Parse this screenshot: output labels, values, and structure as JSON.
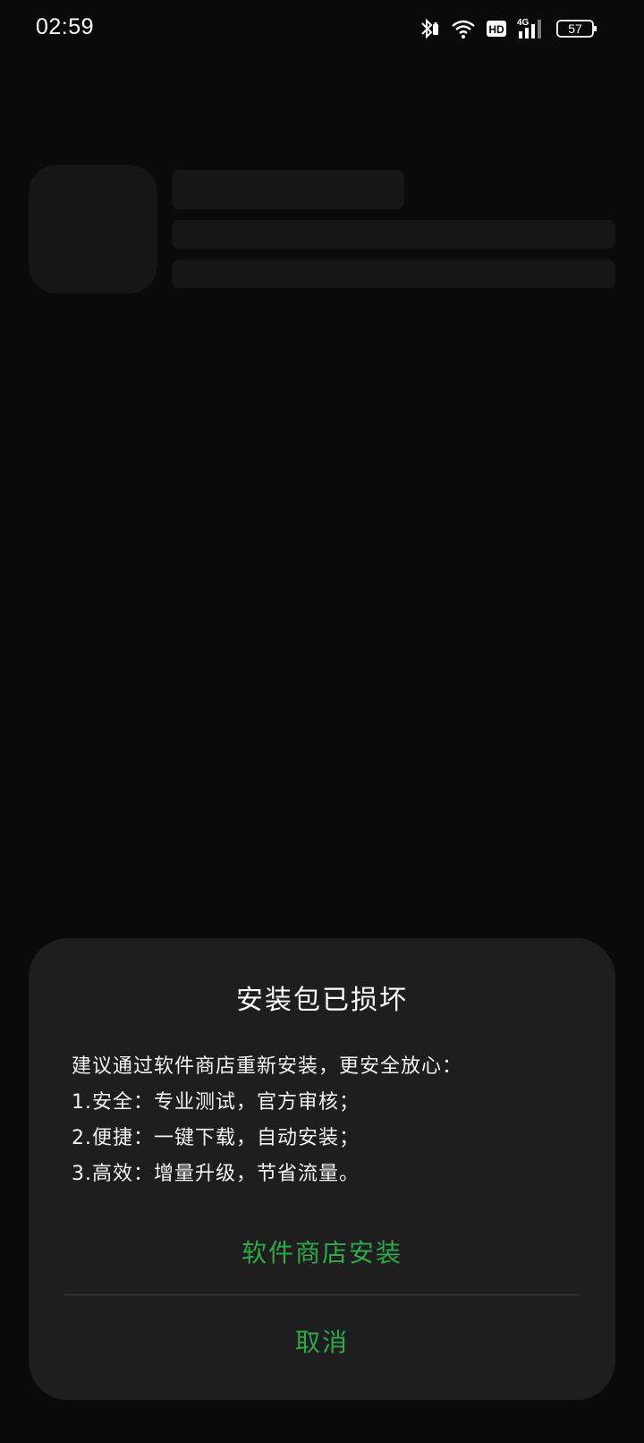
{
  "status_bar": {
    "time": "02:59",
    "network_label": "4G",
    "hd_label": "HD",
    "battery_level": "57",
    "icons": [
      "bluetooth-icon",
      "wifi-icon",
      "hd-icon",
      "signal-4g-icon",
      "battery-icon"
    ]
  },
  "dialog": {
    "title": "安装包已损坏",
    "message_lines": [
      "建议通过软件商店重新安装，更安全放心：",
      "1.安全：专业测试，官方审核；",
      "2.便捷：一键下载，自动安装；",
      "3.高效：增量升级，节省流量。"
    ],
    "primary_action": "软件商店安装",
    "cancel_action": "取消"
  },
  "colors": {
    "background": "#0a0a0a",
    "dialog_background": "#1e1e1e",
    "accent": "#2ea84a",
    "skeleton": "#161616"
  }
}
